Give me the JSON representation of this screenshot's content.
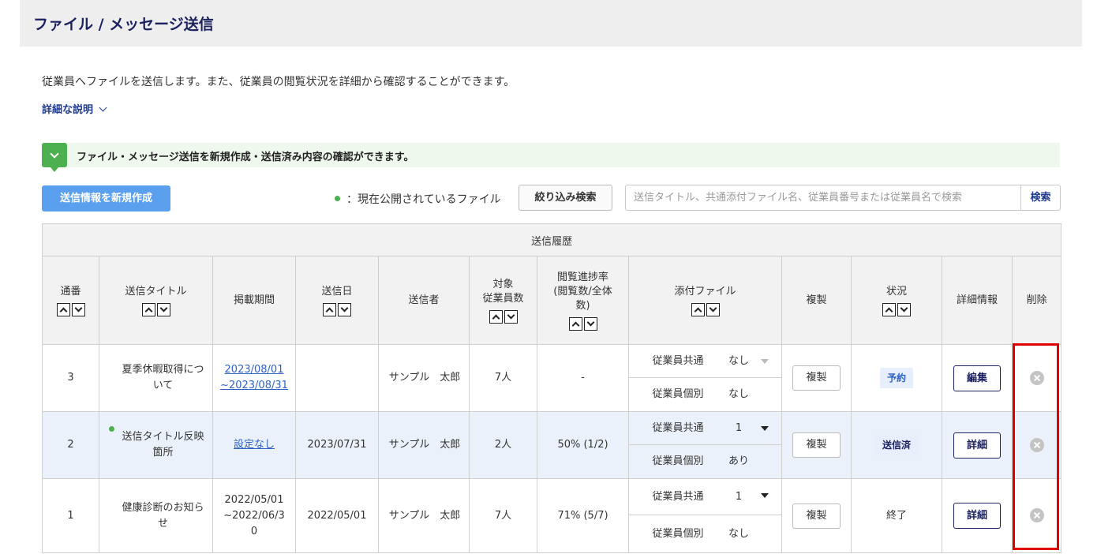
{
  "page": {
    "title": "ファイル / メッセージ送信"
  },
  "description": "従業員へファイルを送信します。また、従業員の閲覧状況を詳細から確認することができます。",
  "detail_toggle": {
    "label": "詳細な説明"
  },
  "info_banner": {
    "text": "ファイル・メッセージ送信を新規作成・送信済み内容の確認ができます。"
  },
  "toolbar": {
    "new_button": "送信情報を新規作成",
    "legend_text": "：現在公開されているファイル",
    "filter_button": "絞り込み検索",
    "search_placeholder": "送信タイトル、共通添付ファイル名、従業員番号または従業員名で検索",
    "search_button": "検索"
  },
  "table": {
    "caption": "送信履歴",
    "headers": {
      "number": "通番",
      "title": "送信タイトル",
      "period": "掲載期間",
      "sent_date": "送信日",
      "sender": "送信者",
      "target": "対象\n従業員数",
      "progress": "閲覧進捗率\n(閲覧数/全体\n数)",
      "attachments": "添付ファイル",
      "copy": "複製",
      "status": "状況",
      "details": "詳細情報",
      "delete": "削除"
    },
    "rows": [
      {
        "number": "3",
        "title": "夏季休暇取得について",
        "published": false,
        "period": "2023/08/01\n~2023/08/31",
        "period_is_link": true,
        "sent_date": "",
        "sender": "サンプル　太郎",
        "target": "7人",
        "progress": "-",
        "files": {
          "common_label": "従業員共通",
          "common_value": "なし",
          "individual_label": "従業員個別",
          "individual_value": "なし"
        },
        "copy": "複製",
        "status": "予約",
        "status_style": "reserved",
        "action": "編集"
      },
      {
        "number": "2",
        "title": "送信タイトル反映箇所",
        "published": true,
        "period": "設定なし",
        "period_is_link": true,
        "sent_date": "2023/07/31",
        "sender": "サンプル　太郎",
        "target": "2人",
        "progress": "50% (1/2)",
        "files": {
          "common_label": "従業員共通",
          "common_value": "1",
          "individual_label": "従業員個別",
          "individual_value": "あり"
        },
        "copy": "複製",
        "status": "送信済",
        "status_style": "sent",
        "action": "詳細"
      },
      {
        "number": "1",
        "title": "健康診断のお知らせ",
        "published": false,
        "period": "2022/05/01\n~2022/06/3\n0",
        "period_is_link": false,
        "sent_date": "2022/05/01",
        "sender": "サンプル　太郎",
        "target": "7人",
        "progress": "71% (5/7)",
        "files": {
          "common_label": "従業員共通",
          "common_value": "1",
          "individual_label": "従業員個別",
          "individual_value": "なし"
        },
        "copy": "複製",
        "status": "終了",
        "status_style": "plain",
        "action": "詳細"
      }
    ]
  },
  "colors": {
    "title_navy": "#1c2260",
    "primary_blue": "#5aa0ee",
    "link_blue": "#2f62c6",
    "public_green": "#4caf50",
    "highlight_red": "#e00000"
  }
}
